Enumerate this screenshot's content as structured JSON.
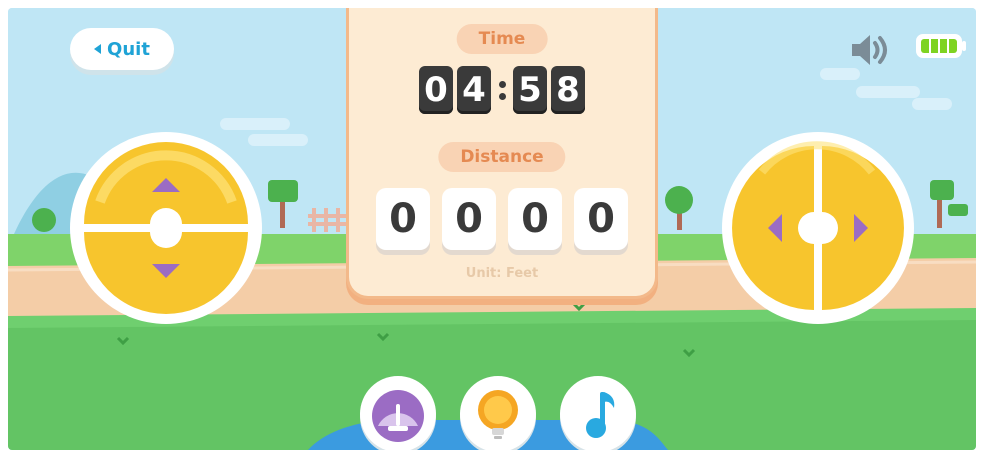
{
  "topbar": {
    "quit_label": "Quit"
  },
  "panel": {
    "time_label": "Time",
    "time_digits": [
      "0",
      "4",
      "5",
      "8"
    ],
    "distance_label": "Distance",
    "distance_digits": [
      "0",
      "0",
      "0",
      "0"
    ],
    "unit_label": "Unit: Feet"
  },
  "status": {
    "battery_level": 1.0
  },
  "bottom_buttons": [
    {
      "icon": "speedometer-icon",
      "color": "#9b6cc4"
    },
    {
      "icon": "lightbulb-icon",
      "color": "#f5a623"
    },
    {
      "icon": "music-note-icon",
      "color": "#29a9e0"
    }
  ],
  "colors": {
    "sky": "#bfe6f5",
    "grass": "#63c464",
    "path": "#f4cda7",
    "water": "#3b9be0",
    "dpad": "#f7c52d",
    "arrow": "#9b6cc4"
  }
}
